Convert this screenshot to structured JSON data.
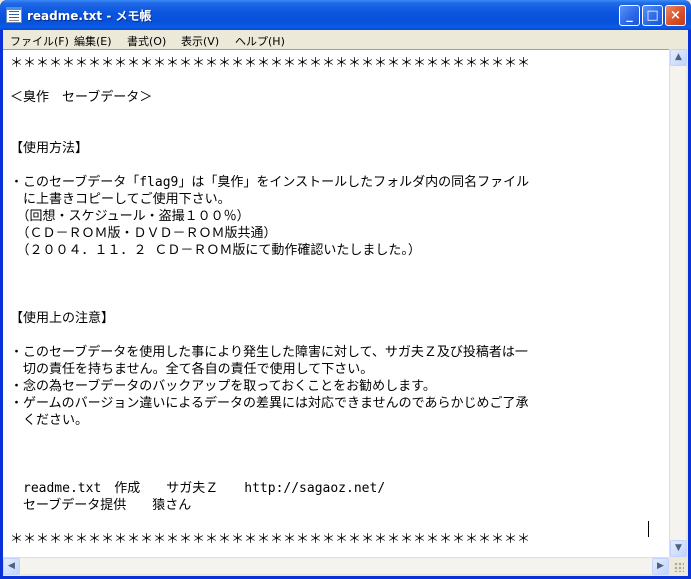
{
  "window": {
    "title": "readme.txt - メモ帳",
    "minimize_glyph": "_",
    "maximize_glyph": "□",
    "close_glyph": "×"
  },
  "menu": {
    "file": "ファイル(F)",
    "edit": "編集(E)",
    "format": "書式(O)",
    "view": "表示(V)",
    "help": "ヘルプ(H)"
  },
  "document": {
    "lines": [
      "＊＊＊＊＊＊＊＊＊＊＊＊＊＊＊＊＊＊＊＊＊＊＊＊＊＊＊＊＊＊＊＊＊＊＊＊＊＊＊＊",
      "",
      "＜臭作　セーブデータ＞",
      "",
      "",
      "【使用方法】",
      "",
      "・このセーブデータ「flag9」は「臭作」をインストールしたフォルダ内の同名ファイル",
      "　に上書きコピーしてご使用下さい。",
      "　（回想・スケジュール・盗撮１００％）",
      "　（ＣＤ－ＲＯＭ版・ＤＶＤ－ＲＯＭ版共通）",
      "　（２００４．１１．２ ＣＤ－ＲＯＭ版にて動作確認いたしました。）",
      "",
      "",
      "",
      "【使用上の注意】",
      "",
      "・このセーブデータを使用した事により発生した障害に対して、サガ夫Ｚ及び投稿者は一",
      "　切の責任を持ちません。全て各自の責任で使用して下さい。",
      "・念の為セーブデータのバックアップを取っておくことをお勧めします。",
      "・ゲームのバージョン違いによるデータの差異には対応できませんのであらかじめご了承",
      "　ください。",
      "",
      "",
      "",
      "　readme.txt　作成　　サガ夫Ｚ　　http://sagaoz.net/",
      "　セーブデータ提供　　猿さん",
      "",
      "＊＊＊＊＊＊＊＊＊＊＊＊＊＊＊＊＊＊＊＊＊＊＊＊＊＊＊＊＊＊＊＊＊＊＊＊＊＊＊＊"
    ]
  },
  "scrollbars": {
    "up_glyph": "▲",
    "down_glyph": "▼",
    "left_glyph": "◀",
    "right_glyph": "▶"
  }
}
